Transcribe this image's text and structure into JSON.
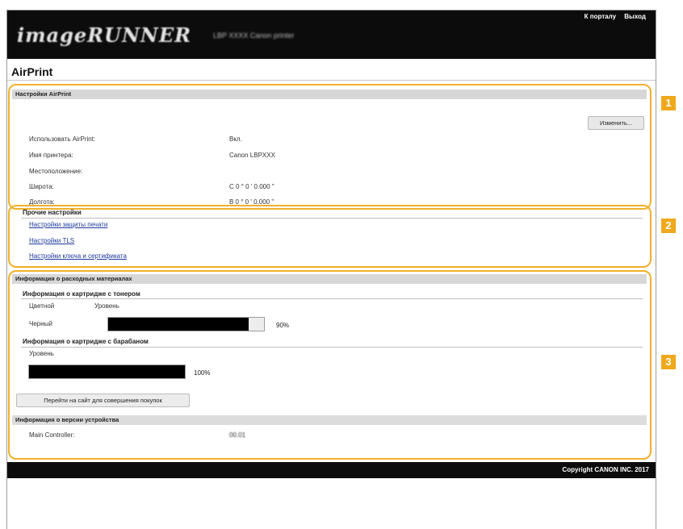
{
  "header": {
    "logo_text": "imageRUNNER",
    "device_name": "LBP XXXX Canon printer",
    "links": [
      "К порталу",
      "Выход"
    ]
  },
  "page_title": "AirPrint",
  "airprint_settings": {
    "header": "Настройки AirPrint",
    "edit_button": "Изменить...",
    "rows": [
      {
        "label": "Использовать AirPrint:",
        "value": "Вкл."
      },
      {
        "label": "Имя принтера:",
        "value": "Canon LBPXXX"
      },
      {
        "label": "Местоположение:",
        "value": ""
      },
      {
        "label": "Широта:",
        "value": "С 0 ° 0 ' 0.000 \""
      },
      {
        "label": "Долгота:",
        "value": "В 0 ° 0 ' 0.000 \""
      }
    ]
  },
  "other_settings": {
    "header": "Прочие настройки",
    "links": [
      "Настройки защиты печати",
      "Настройки TLS",
      "Настройки ключа и сертификата"
    ]
  },
  "consumables": {
    "header": "Информация о расходных материалах",
    "toner": {
      "title": "Информация о картридже с тонером",
      "col_color": "Цветной",
      "col_level": "Уровень",
      "color_name": "Черный",
      "level_percent": 90,
      "level_text": "90%"
    },
    "drum": {
      "title": "Информация о картридже с барабаном",
      "col_level": "Уровень",
      "level_percent": 100,
      "level_text": "100%"
    },
    "shop_button": "Перейти на сайт для совершения покупок",
    "version": {
      "title": "Информация о версии устройства",
      "label": "Main Controller:",
      "value": "00.01"
    }
  },
  "footer": {
    "copyright": "Copyright CANON INC. 2017"
  },
  "callouts": [
    "1",
    "2",
    "3"
  ],
  "colors": {
    "callout": "#f0a81c",
    "outline": "#f0b02a",
    "header_bg": "#0c0c0c"
  }
}
